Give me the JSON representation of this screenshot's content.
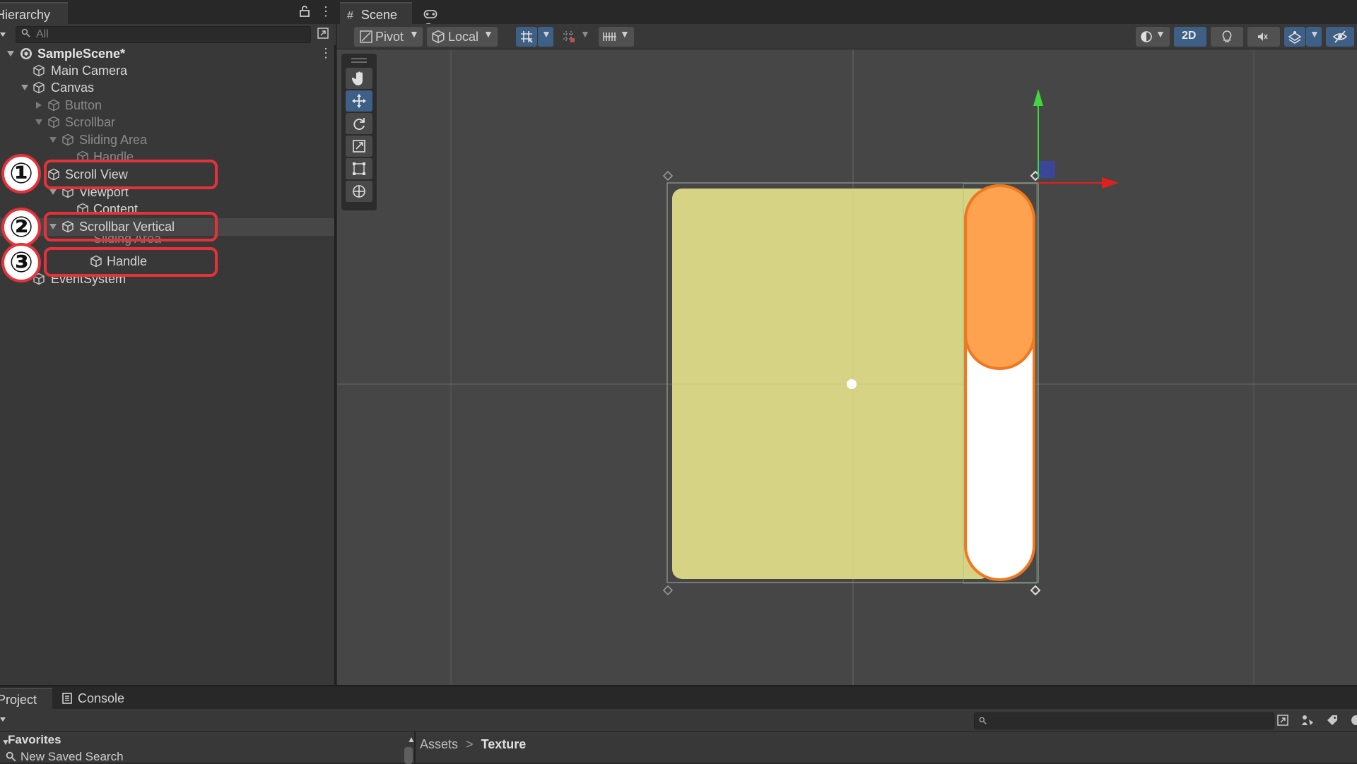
{
  "hierarchy": {
    "tab_label": "Hierarchy",
    "search_placeholder": "All",
    "scene_name": "SampleScene*",
    "items": [
      {
        "label": "Main Camera"
      },
      {
        "label": "Canvas"
      },
      {
        "label": "Button"
      },
      {
        "label": "Scrollbar"
      },
      {
        "label": "Sliding Area"
      },
      {
        "label": "Handle"
      },
      {
        "label": "Scroll View"
      },
      {
        "label": "Viewport"
      },
      {
        "label": "Content"
      },
      {
        "label": "Scrollbar Vertical"
      },
      {
        "label": "Sliding Area"
      },
      {
        "label": "Handle"
      },
      {
        "label": "EventSystem"
      }
    ]
  },
  "callouts": [
    "①",
    "②",
    "③"
  ],
  "scene": {
    "tabs": [
      "Scene",
      "Game"
    ],
    "toolbar": {
      "pivot_label": "Pivot",
      "local_label": "Local",
      "mode_2d_label": "2D"
    }
  },
  "project": {
    "tab_label": "Project",
    "console_label": "Console",
    "favorites_label": "Favorites",
    "saved_search_label": "New Saved Search",
    "breadcrumb_root": "Assets",
    "breadcrumb_separator": ">",
    "breadcrumb_current": "Texture"
  },
  "colors": {
    "panel_bg": "#d6d484",
    "scrollbar_handle": "#ffa24f",
    "scrollbar_border": "#f07820",
    "callout_red": "#e5323a",
    "gizmo_y": "#3fd63f",
    "gizmo_x": "#e02020",
    "active_blue": "#3e5f86"
  },
  "icons": [
    "search-icon",
    "lock-icon",
    "menu-dots-icon",
    "cube-icon",
    "unity-scene-icon",
    "hand-tool-icon",
    "move-tool-icon",
    "rotate-tool-icon",
    "scale-tool-icon",
    "rect-tool-icon",
    "transform-tool-icon",
    "grid-icon",
    "snap-icon",
    "ruler-icon",
    "lighting-icon",
    "audio-icon",
    "effects-icon",
    "visibility-icon",
    "gamepad-icon",
    "console-icon",
    "star-icon"
  ]
}
